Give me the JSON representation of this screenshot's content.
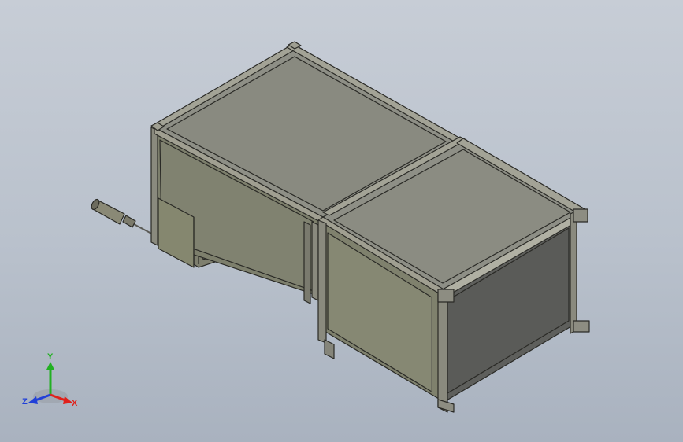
{
  "viewport": {
    "background_top": "#c7cdd6",
    "background_bottom": "#a9b2bf"
  },
  "model": {
    "frame_color": "#8c8c80",
    "panel_top_color": "#8e8f86",
    "panel_front_color": "#7d7f6c",
    "panel_side_color": "#5e5f5c",
    "edge_color": "#2a2a26"
  },
  "triad": {
    "x_label": "X",
    "y_label": "Y",
    "z_label": "Z",
    "x_color": "#e0201a",
    "y_color": "#22b022",
    "z_color": "#2140d8"
  }
}
